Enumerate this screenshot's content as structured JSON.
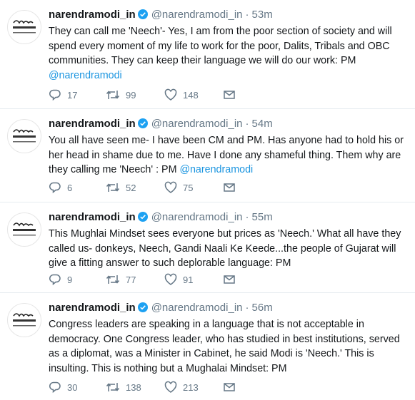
{
  "tweets": [
    {
      "author_name": "narendramodi_in",
      "handle": "@narendramodi_in",
      "separator": "·",
      "time": "53m",
      "text": "They can call me 'Neech'- Yes, I am from the poor section of society and will spend every moment of my life to work for the poor, Dalits, Tribals and OBC communities. They can keep their language we will do our work: PM",
      "mention": "@narendramodi",
      "replies": "17",
      "retweets": "99",
      "likes": "148"
    },
    {
      "author_name": "narendramodi_in",
      "handle": "@narendramodi_in",
      "separator": "·",
      "time": "54m",
      "text": "You all have seen me- I have been CM and PM. Has anyone had to hold his or her head in shame due to me. Have I done any shameful thing. Them why are they calling me 'Neech' : PM",
      "mention": "@narendramodi",
      "replies": "6",
      "retweets": "52",
      "likes": "75"
    },
    {
      "author_name": "narendramodi_in",
      "handle": "@narendramodi_in",
      "separator": "·",
      "time": "55m",
      "text": "This Mughlai Mindset sees everyone but prices as 'Neech.' What all have they called us- donkeys, Neech, Gandi Naali Ke Keede...the people of Gujarat will give a fitting answer to such deplorable language: PM",
      "mention": "",
      "replies": "9",
      "retweets": "77",
      "likes": "91"
    },
    {
      "author_name": "narendramodi_in",
      "handle": "@narendramodi_in",
      "separator": "·",
      "time": "56m",
      "text": "Congress leaders are speaking in a language that is not acceptable in democracy. One Congress leader, who has studied in best institutions, served as a diplomat, was a Minister in Cabinet, he said Modi is 'Neech.' This is insulting. This is nothing but a Mughalai Mindset: PM",
      "mention": "",
      "replies": "30",
      "retweets": "138",
      "likes": "213"
    }
  ],
  "icons": {
    "reply": "reply-icon",
    "retweet": "retweet-icon",
    "like": "heart-icon",
    "message": "envelope-icon",
    "verified": "verified-badge-icon"
  },
  "colors": {
    "text": "#14171a",
    "secondary": "#657786",
    "link": "#1b95e0",
    "verified": "#1da1f2",
    "divider": "#e6ecf0"
  }
}
